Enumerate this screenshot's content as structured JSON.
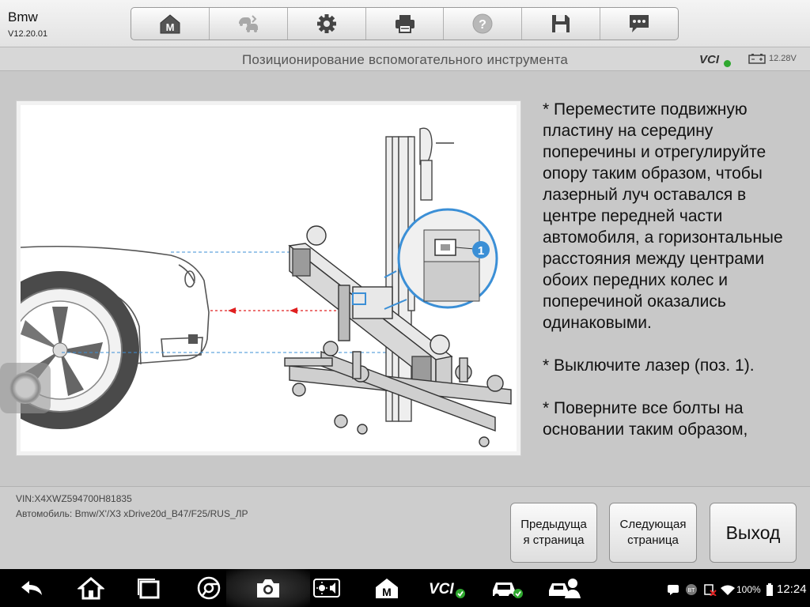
{
  "app": {
    "name": "Bmw",
    "version": "V12.20.01"
  },
  "toolbar": {
    "buttons": [
      {
        "name": "home-button",
        "icon": "m-home-icon"
      },
      {
        "name": "vehicle-swap-button",
        "icon": "car-swap-icon"
      },
      {
        "name": "settings-button",
        "icon": "gear-icon"
      },
      {
        "name": "print-button",
        "icon": "printer-icon"
      },
      {
        "name": "help-button",
        "icon": "help-icon"
      },
      {
        "name": "save-button",
        "icon": "floppy-icon"
      },
      {
        "name": "message-button",
        "icon": "chat-icon"
      }
    ]
  },
  "header": {
    "title": "Позиционирование вспомогательного инструмента",
    "vci": "VCI",
    "voltage": "12.28V"
  },
  "illustration": {
    "callout": "1"
  },
  "instructions": [
    "* Переместите подвижную пластину на середину поперечины и отрегулируйте опору таким образом, чтобы лазерный луч оставался в центре передней части автомобиля, а горизонтальные расстояния между центрами обоих передних колес и поперечиной оказались одинаковыми.",
    "* Выключите лазер (поз. 1).",
    "* Поверните все болты на основании таким образом,"
  ],
  "footer": {
    "vin": "VIN:X4XWZ594700H81835",
    "vehicle": "Автомобиль: Bmw/X'/X3 xDrive20d_B47/F25/RUS_ЛР",
    "prev_label_1": "Предыдуща",
    "prev_label_2": "я страница",
    "next_label_1": "Следующая",
    "next_label_2": "страница",
    "exit_label": "Выход"
  },
  "system": {
    "battery": "100%",
    "time": "12:24",
    "vci_nav": "VCI"
  },
  "colors": {
    "laser": "#e02020",
    "guide": "#3b8fd6",
    "status_ok": "#2fa82f"
  }
}
